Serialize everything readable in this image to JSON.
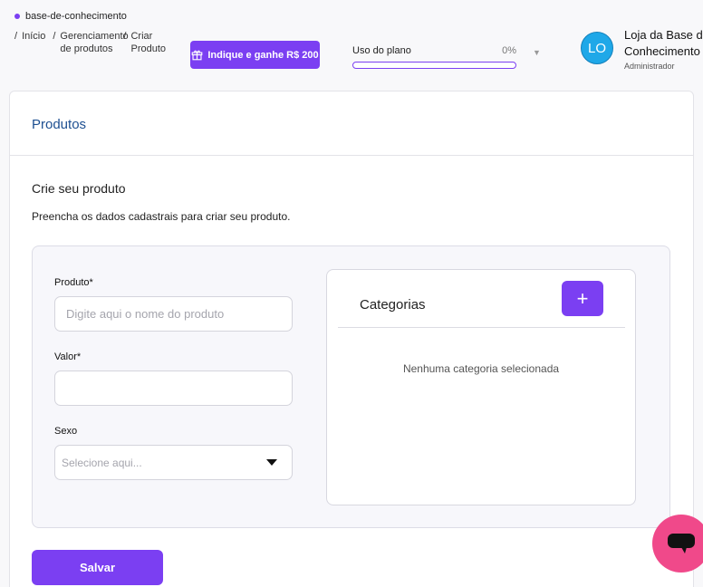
{
  "header": {
    "store_name": "base-de-conhecimento",
    "breadcrumb": [
      {
        "label": "Início"
      },
      {
        "label": "Gerenciamento de produtos"
      },
      {
        "label": "Criar Produto"
      }
    ],
    "refer_button": "Indique e ganhe R$ 200",
    "plan": {
      "label": "Uso do plano",
      "percent_label": "0%",
      "percent": 0
    },
    "user": {
      "initials": "LO",
      "name": "Loja da Base de Conhecimento",
      "role": "Administrador"
    }
  },
  "card": {
    "title": "Produtos",
    "subtitle": "Crie seu produto",
    "description": "Preencha os dados cadastrais para criar seu produto."
  },
  "form": {
    "product_label": "Produto*",
    "product_placeholder": "Digite aqui o nome do produto",
    "product_value": "",
    "value_label": "Valor*",
    "value_value": "",
    "sex_label": "Sexo",
    "sex_placeholder": "Selecione aqui..."
  },
  "categories": {
    "title": "Categorias",
    "add_label": "+",
    "empty_text": "Nenhuma categoria selecionada"
  },
  "save_label": "Salvar",
  "colors": {
    "accent": "#7b3ff2",
    "title_blue": "#1d4f91",
    "avatar": "#1fa8e8",
    "chat": "#f0498a"
  },
  "icons": {
    "refer": "gift-icon",
    "plan_toggle": "caret-down-icon",
    "select": "caret-down-icon",
    "chat": "chat-bubble-icon"
  }
}
